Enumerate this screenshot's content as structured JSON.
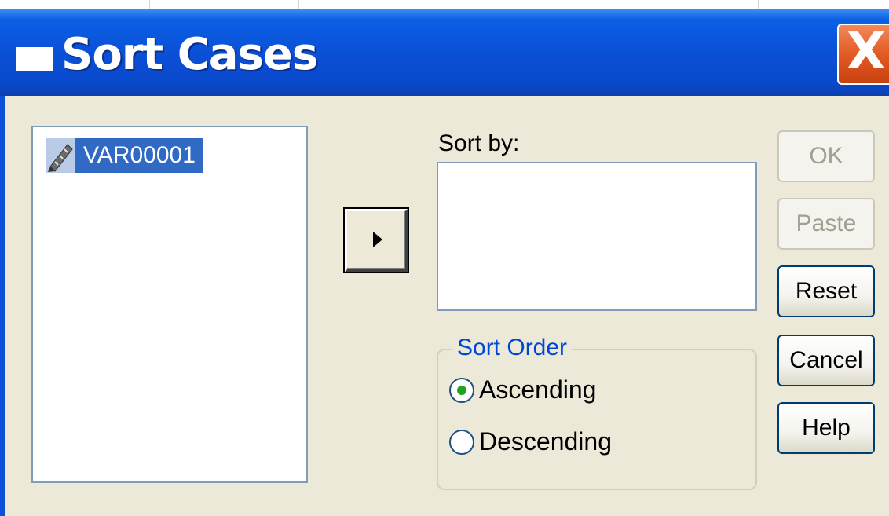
{
  "window": {
    "title": "Sort Cases",
    "title_icon": "window-icon",
    "close_glyph": "X"
  },
  "variables": {
    "items": [
      {
        "label": "VAR00001",
        "icon": "pencil-scale-icon",
        "selected": true
      }
    ]
  },
  "move_button": {
    "icon": "right-arrow-icon"
  },
  "sort_by": {
    "label": "Sort by:",
    "items": []
  },
  "sort_order": {
    "title": "Sort Order",
    "options": [
      {
        "label": "Ascending",
        "selected": true
      },
      {
        "label": "Descending",
        "selected": false
      }
    ]
  },
  "buttons": {
    "ok": {
      "label": "OK",
      "enabled": false
    },
    "paste": {
      "label": "Paste",
      "enabled": false
    },
    "reset": {
      "label": "Reset",
      "enabled": true
    },
    "cancel": {
      "label": "Cancel",
      "enabled": true
    },
    "help": {
      "label": "Help",
      "enabled": true
    }
  },
  "colors": {
    "title_bar": "#0a4fd6",
    "selection": "#316ac5",
    "group_title": "#0046d5",
    "close_button": "#e35a24",
    "radio_dot": "#21a121"
  }
}
